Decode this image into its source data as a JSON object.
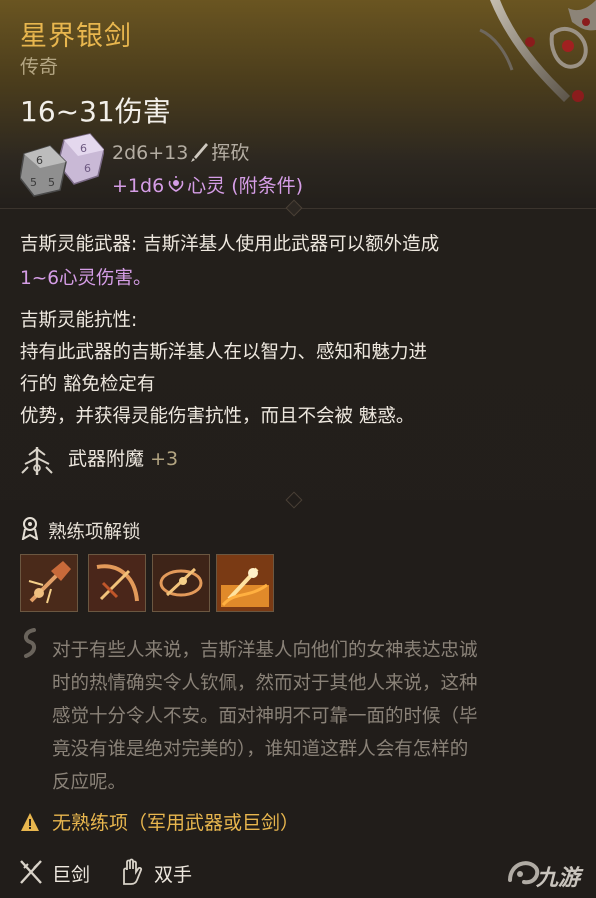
{
  "item": {
    "name": "星界银剑",
    "rarity": "传奇",
    "damage_range": "16~31伤害",
    "damage_main": "2d6+13",
    "damage_main_type": "挥砍",
    "damage_extra": "+1d6",
    "damage_extra_type": "心灵 (附条件)"
  },
  "passives": {
    "p1_title": "吉斯灵能武器:",
    "p1_body": " 吉斯洋基人使用此武器可以额外造成",
    "p1_psy": "1~6心灵伤害。",
    "p2_title": "吉斯灵能抗性:",
    "p2_line1": "持有此武器的吉斯洋基人在以智力、感知和魅力进",
    "p2_line2": "行的 豁免检定有",
    "p2_line3": "优势，并获得灵能伤害抗性，而且不会被 魅惑。"
  },
  "enchant": {
    "label": "武器附魔",
    "value": "+3"
  },
  "proficiency": {
    "header": "熟练项解锁",
    "skills": [
      "skill-1",
      "skill-2",
      "skill-3",
      "skill-4"
    ]
  },
  "lore": [
    "对于有些人来说，吉斯洋基人向他们的女神表达忠诚",
    "时的热情确实令人钦佩，然而对于其他人来说，这种",
    "感觉十分令人不安。面对神明不可靠一面的时候（毕",
    "竟没有谁是绝对完美的），谁知道这群人会有怎样的",
    "反应呢。"
  ],
  "warning": "无熟练项（军用武器或巨剑）",
  "tags": {
    "weapon_type": "巨剑",
    "handedness": "双手"
  },
  "watermark": "九游",
  "colors": {
    "title": "#e8b64e",
    "psychic": "#d59de6",
    "lore": "#8a8278"
  }
}
